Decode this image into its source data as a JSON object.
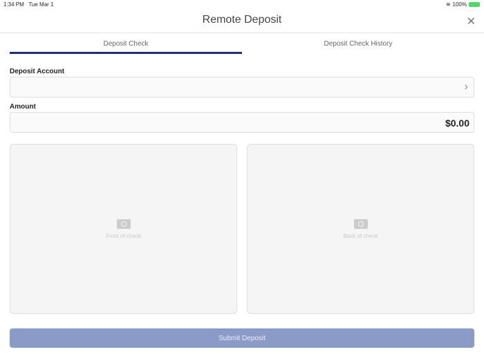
{
  "status": {
    "time": "1:34 PM",
    "date": "Tue Mar 1",
    "battery": "100%"
  },
  "header": {
    "title": "Remote Deposit",
    "close": "✕"
  },
  "tabs": [
    {
      "label": "Deposit Check",
      "active": true
    },
    {
      "label": "Deposit Check History",
      "active": false
    }
  ],
  "form": {
    "account_label": "Deposit Account",
    "account_value": "",
    "amount_label": "Amount",
    "amount_value": "$0.00"
  },
  "cards": {
    "front": "Front of check",
    "back": "Back of check"
  },
  "submit": "Submit Deposit"
}
